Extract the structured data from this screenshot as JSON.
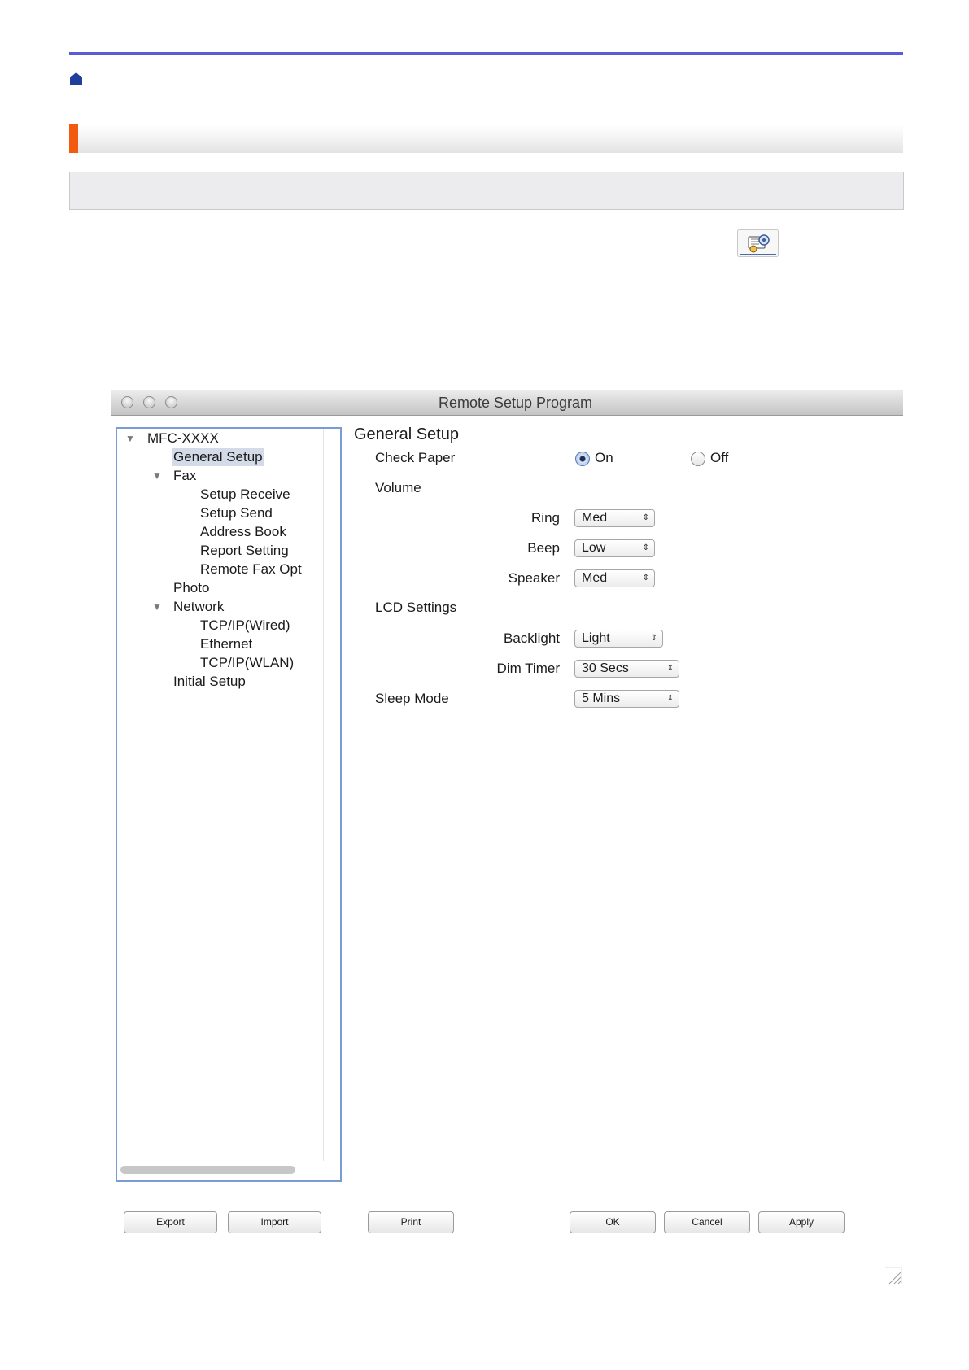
{
  "window": {
    "title": "Remote Setup Program"
  },
  "tree": {
    "root": "MFC-XXXX",
    "items": [
      {
        "label": "General Setup"
      },
      {
        "label": "Fax"
      },
      {
        "label": "Setup Receive"
      },
      {
        "label": "Setup Send"
      },
      {
        "label": "Address Book"
      },
      {
        "label": "Report Setting"
      },
      {
        "label": "Remote Fax Opt"
      },
      {
        "label": "Photo"
      },
      {
        "label": "Network"
      },
      {
        "label": "TCP/IP(Wired)"
      },
      {
        "label": "Ethernet"
      },
      {
        "label": "TCP/IP(WLAN)"
      },
      {
        "label": "Initial Setup"
      }
    ],
    "selected": "General Setup"
  },
  "settings": {
    "title": "General Setup",
    "check_paper": {
      "label": "Check Paper",
      "on_label": "On",
      "off_label": "Off",
      "value": "On"
    },
    "volume": {
      "label": "Volume",
      "ring": {
        "label": "Ring",
        "value": "Med"
      },
      "beep": {
        "label": "Beep",
        "value": "Low"
      },
      "speaker": {
        "label": "Speaker",
        "value": "Med"
      }
    },
    "lcd": {
      "label": "LCD Settings",
      "backlight": {
        "label": "Backlight",
        "value": "Light"
      },
      "dim_timer": {
        "label": "Dim Timer",
        "value": "30 Secs"
      }
    },
    "sleep_mode": {
      "label": "Sleep Mode",
      "value": "5 Mins"
    }
  },
  "buttons": {
    "export": "Export",
    "import": "Import",
    "print": "Print",
    "ok": "OK",
    "cancel": "Cancel",
    "apply": "Apply"
  },
  "icons": {
    "home": "home-icon",
    "settings": "remote-setup-icon",
    "resize": "resize-grip-icon"
  },
  "colors": {
    "top_rule": "#5b5bd6",
    "section_accent": "#f25a0f",
    "home": "#1f3f9a",
    "tree_border": "#7a9bd4"
  }
}
